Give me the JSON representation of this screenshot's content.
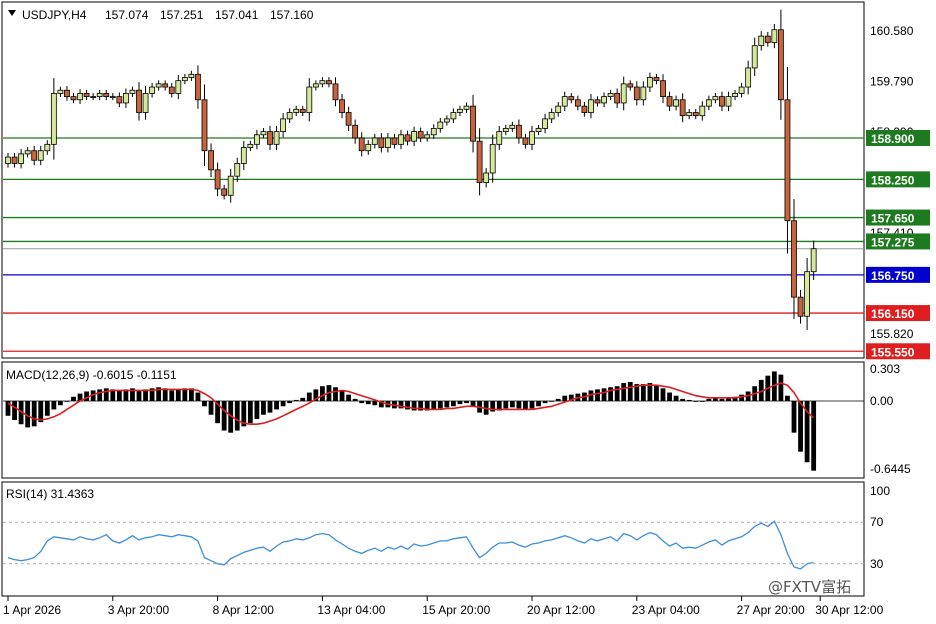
{
  "colors": {
    "bull": "#d6e89a",
    "bear": "#c8643c",
    "level_green": "#1e7a1e",
    "level_blue": "#0000cc",
    "level_red": "#dd1f1f",
    "macd_signal": "#dd1f1f",
    "rsi_line": "#3b8fdc"
  },
  "chart_data": [
    {
      "type": "candlestick",
      "header": {
        "symbol_label": "USDJPY,H4",
        "open": "157.074",
        "high": "157.251",
        "low": "157.041",
        "close": "157.160"
      },
      "ylim": [
        155.46,
        161.02
      ],
      "ytick_labels": [
        "160.580",
        "159.790",
        "158.990",
        "157.410",
        "155.820"
      ],
      "ytick_values": [
        160.58,
        159.79,
        158.99,
        157.41,
        155.82
      ],
      "bid_price": 157.16,
      "levels": [
        {
          "label": "158.900",
          "value": 158.9,
          "color": "green"
        },
        {
          "label": "158.250",
          "value": 158.25,
          "color": "green"
        },
        {
          "label": "157.650",
          "value": 157.65,
          "color": "green"
        },
        {
          "label": "157.275",
          "value": 157.275,
          "color": "green"
        },
        {
          "label": "156.750",
          "value": 156.75,
          "color": "blue"
        },
        {
          "label": "156.150",
          "value": 156.15,
          "color": "red"
        },
        {
          "label": "155.550",
          "value": 155.55,
          "color": "red"
        }
      ],
      "closes": [
        158.6,
        158.5,
        158.65,
        158.7,
        158.55,
        158.7,
        158.8,
        159.6,
        159.65,
        159.55,
        159.5,
        159.6,
        159.55,
        159.55,
        159.6,
        159.55,
        159.55,
        159.45,
        159.6,
        159.65,
        159.3,
        159.6,
        159.7,
        159.75,
        159.7,
        159.6,
        159.8,
        159.85,
        159.9,
        159.5,
        158.7,
        158.4,
        158.1,
        158.0,
        158.3,
        158.5,
        158.75,
        158.8,
        158.95,
        159.0,
        158.8,
        159.0,
        159.2,
        159.3,
        159.35,
        159.3,
        159.7,
        159.75,
        159.8,
        159.75,
        159.5,
        159.3,
        159.1,
        158.9,
        158.7,
        158.8,
        158.9,
        158.75,
        158.9,
        158.8,
        158.95,
        158.85,
        159.0,
        158.9,
        158.95,
        159.05,
        159.15,
        159.2,
        159.3,
        159.35,
        159.4,
        158.85,
        158.2,
        158.35,
        158.8,
        159.0,
        159.05,
        159.1,
        158.9,
        158.8,
        159.0,
        159.05,
        159.2,
        159.3,
        159.4,
        159.55,
        159.5,
        159.4,
        159.3,
        159.5,
        159.45,
        159.55,
        159.6,
        159.45,
        159.75,
        159.7,
        159.5,
        159.7,
        159.85,
        159.8,
        159.55,
        159.4,
        159.5,
        159.25,
        159.3,
        159.25,
        159.4,
        159.5,
        159.55,
        159.4,
        159.55,
        159.6,
        159.7,
        160.0,
        160.35,
        160.5,
        160.4,
        160.6,
        159.5,
        157.6,
        156.4,
        156.1,
        156.8,
        157.16
      ],
      "x_tick_labels": [
        "1 Apr 2026",
        "3 Apr 20:00",
        "8 Apr 12:00",
        "13 Apr 04:00",
        "15 Apr 20:00",
        "20 Apr 12:00",
        "23 Apr 04:00",
        "27 Apr 20:00",
        "30 Apr 12:00"
      ],
      "x_tick_bars": [
        0,
        16,
        32,
        48,
        64,
        80,
        96,
        112,
        124
      ]
    },
    {
      "type": "bar",
      "header": "MACD(12,26,9) -0.6015 -0.1151",
      "ylim": [
        -0.72,
        0.36
      ],
      "ytick_labels": [
        "0.303",
        "0.00",
        "-0.6445"
      ],
      "ytick_values": [
        0.303,
        0.0,
        -0.6445
      ],
      "histogram": [
        -0.14,
        -0.18,
        -0.22,
        -0.25,
        -0.24,
        -0.2,
        -0.14,
        -0.08,
        -0.04,
        0.0,
        0.04,
        0.07,
        0.09,
        0.1,
        0.11,
        0.12,
        0.11,
        0.1,
        0.11,
        0.12,
        0.1,
        0.11,
        0.12,
        0.13,
        0.12,
        0.1,
        0.11,
        0.12,
        0.12,
        0.08,
        -0.05,
        -0.13,
        -0.21,
        -0.28,
        -0.3,
        -0.28,
        -0.24,
        -0.21,
        -0.17,
        -0.13,
        -0.11,
        -0.08,
        -0.05,
        -0.02,
        0.01,
        0.03,
        0.08,
        0.11,
        0.14,
        0.15,
        0.13,
        0.1,
        0.06,
        0.02,
        -0.02,
        -0.03,
        -0.04,
        -0.06,
        -0.06,
        -0.07,
        -0.07,
        -0.08,
        -0.09,
        -0.09,
        -0.09,
        -0.08,
        -0.07,
        -0.06,
        -0.05,
        -0.03,
        -0.02,
        -0.05,
        -0.11,
        -0.13,
        -0.1,
        -0.09,
        -0.07,
        -0.06,
        -0.07,
        -0.08,
        -0.07,
        -0.05,
        -0.02,
        0.0,
        0.02,
        0.05,
        0.06,
        0.07,
        0.08,
        0.1,
        0.11,
        0.12,
        0.13,
        0.14,
        0.17,
        0.18,
        0.16,
        0.16,
        0.17,
        0.15,
        0.12,
        0.08,
        0.05,
        0.02,
        0.01,
        0.0,
        0.0,
        0.02,
        0.03,
        0.02,
        0.03,
        0.04,
        0.06,
        0.09,
        0.14,
        0.2,
        0.24,
        0.28,
        0.25,
        0.05,
        -0.3,
        -0.48,
        -0.58,
        -0.66
      ],
      "signal": [
        -0.02,
        -0.06,
        -0.1,
        -0.14,
        -0.17,
        -0.18,
        -0.17,
        -0.15,
        -0.12,
        -0.08,
        -0.04,
        0.0,
        0.03,
        0.06,
        0.08,
        0.09,
        0.1,
        0.1,
        0.1,
        0.1,
        0.1,
        0.1,
        0.1,
        0.11,
        0.11,
        0.11,
        0.11,
        0.11,
        0.11,
        0.1,
        0.07,
        0.03,
        -0.03,
        -0.09,
        -0.14,
        -0.18,
        -0.21,
        -0.22,
        -0.22,
        -0.21,
        -0.19,
        -0.17,
        -0.14,
        -0.11,
        -0.08,
        -0.05,
        -0.02,
        0.02,
        0.05,
        0.08,
        0.09,
        0.1,
        0.09,
        0.07,
        0.05,
        0.03,
        0.01,
        -0.01,
        -0.03,
        -0.04,
        -0.05,
        -0.06,
        -0.07,
        -0.07,
        -0.08,
        -0.08,
        -0.08,
        -0.07,
        -0.07,
        -0.06,
        -0.05,
        -0.05,
        -0.06,
        -0.07,
        -0.08,
        -0.08,
        -0.08,
        -0.08,
        -0.08,
        -0.08,
        -0.08,
        -0.07,
        -0.06,
        -0.05,
        -0.03,
        -0.01,
        0.01,
        0.03,
        0.04,
        0.06,
        0.07,
        0.08,
        0.1,
        0.11,
        0.12,
        0.13,
        0.14,
        0.15,
        0.15,
        0.15,
        0.14,
        0.13,
        0.11,
        0.09,
        0.07,
        0.05,
        0.04,
        0.03,
        0.03,
        0.03,
        0.03,
        0.03,
        0.04,
        0.05,
        0.07,
        0.09,
        0.12,
        0.15,
        0.17,
        0.15,
        0.08,
        -0.02,
        -0.1,
        -0.16
      ]
    },
    {
      "type": "line",
      "header": "RSI(14) 31.4363",
      "ylim": [
        0,
        100
      ],
      "ytick_labels": [
        "100",
        "70",
        "30"
      ],
      "ytick_values": [
        100,
        70,
        30
      ],
      "levels": [
        70,
        30
      ],
      "values": [
        36,
        34,
        33,
        34,
        36,
        42,
        52,
        56,
        55,
        54,
        53,
        56,
        54,
        53,
        55,
        58,
        52,
        50,
        53,
        57,
        53,
        55,
        56,
        58,
        57,
        56,
        58,
        57,
        56,
        52,
        36,
        33,
        30,
        29,
        35,
        38,
        41,
        43,
        45,
        46,
        42,
        47,
        51,
        52,
        54,
        53,
        55,
        58,
        59,
        58,
        53,
        49,
        45,
        42,
        40,
        43,
        45,
        42,
        46,
        44,
        47,
        44,
        49,
        47,
        48,
        50,
        52,
        52,
        54,
        55,
        56,
        45,
        36,
        40,
        46,
        50,
        50,
        51,
        48,
        46,
        49,
        50,
        52,
        53,
        55,
        57,
        55,
        52,
        50,
        54,
        52,
        54,
        56,
        52,
        59,
        57,
        53,
        57,
        60,
        58,
        52,
        47,
        50,
        45,
        46,
        45,
        48,
        51,
        53,
        48,
        52,
        54,
        56,
        60,
        66,
        69,
        66,
        71,
        58,
        40,
        27,
        25,
        30,
        31.4
      ]
    }
  ],
  "watermark": "@FXTV富拓"
}
